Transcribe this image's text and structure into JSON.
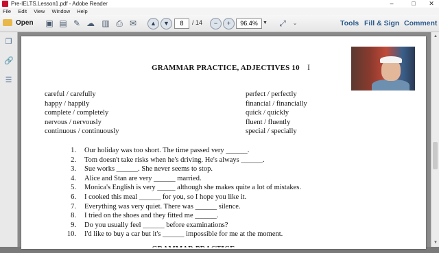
{
  "window": {
    "title": "Pre-IELTS.Lesson1.pdf - Adobe Reader",
    "controls": [
      "–",
      "□",
      "✕"
    ]
  },
  "menu": [
    "File",
    "Edit",
    "View",
    "Window",
    "Help"
  ],
  "toolbar": {
    "open_label": "Open",
    "current_page": "8",
    "total_pages": "/ 14",
    "zoom": "96.4%",
    "tools_label": "Tools",
    "fill_sign_label": "Fill & Sign",
    "comment_label": "Comment"
  },
  "document": {
    "title": "GRAMMAR PRACTICE, ADJECTIVES 10",
    "word_pairs_left": [
      "careful / carefully",
      "happy / happily",
      "complete / completely",
      "nervous / nervously",
      "continuous / continuously"
    ],
    "word_pairs_right": [
      "perfect / perfectly",
      "financial / financially",
      "quick / quickly",
      "fluent / fluently",
      "special / specially"
    ],
    "exercises": [
      {
        "num": "1.",
        "text": "Our holiday was too short. The time passed very ______."
      },
      {
        "num": "2.",
        "text": "Tom doesn't take risks when he's driving. He's always ______."
      },
      {
        "num": "3.",
        "text": "Sue works ______. She never seems to stop."
      },
      {
        "num": "4.",
        "text": "Alice and Stan are very ______ married."
      },
      {
        "num": "5.",
        "text": "Monica's English is very _____ although she makes quite a lot of mistakes."
      },
      {
        "num": "6.",
        "text": "I cooked this meal ______ for you, so I hope you like it."
      },
      {
        "num": "7.",
        "text": "Everything was very quiet. There was ______ silence."
      },
      {
        "num": "8.",
        "text": "I tried on the shoes and they fitted me ______."
      },
      {
        "num": "9.",
        "text": "Do you usually feel ______ before examinations?"
      },
      {
        "num": "10.",
        "text": "I'd like to buy a car but it's ______ impossible for me at the moment."
      }
    ],
    "next_heading": "GRAMMAR PRACTICE"
  },
  "colors": {
    "accent": "#2b5a8c",
    "app_icon": "#c8102e"
  }
}
